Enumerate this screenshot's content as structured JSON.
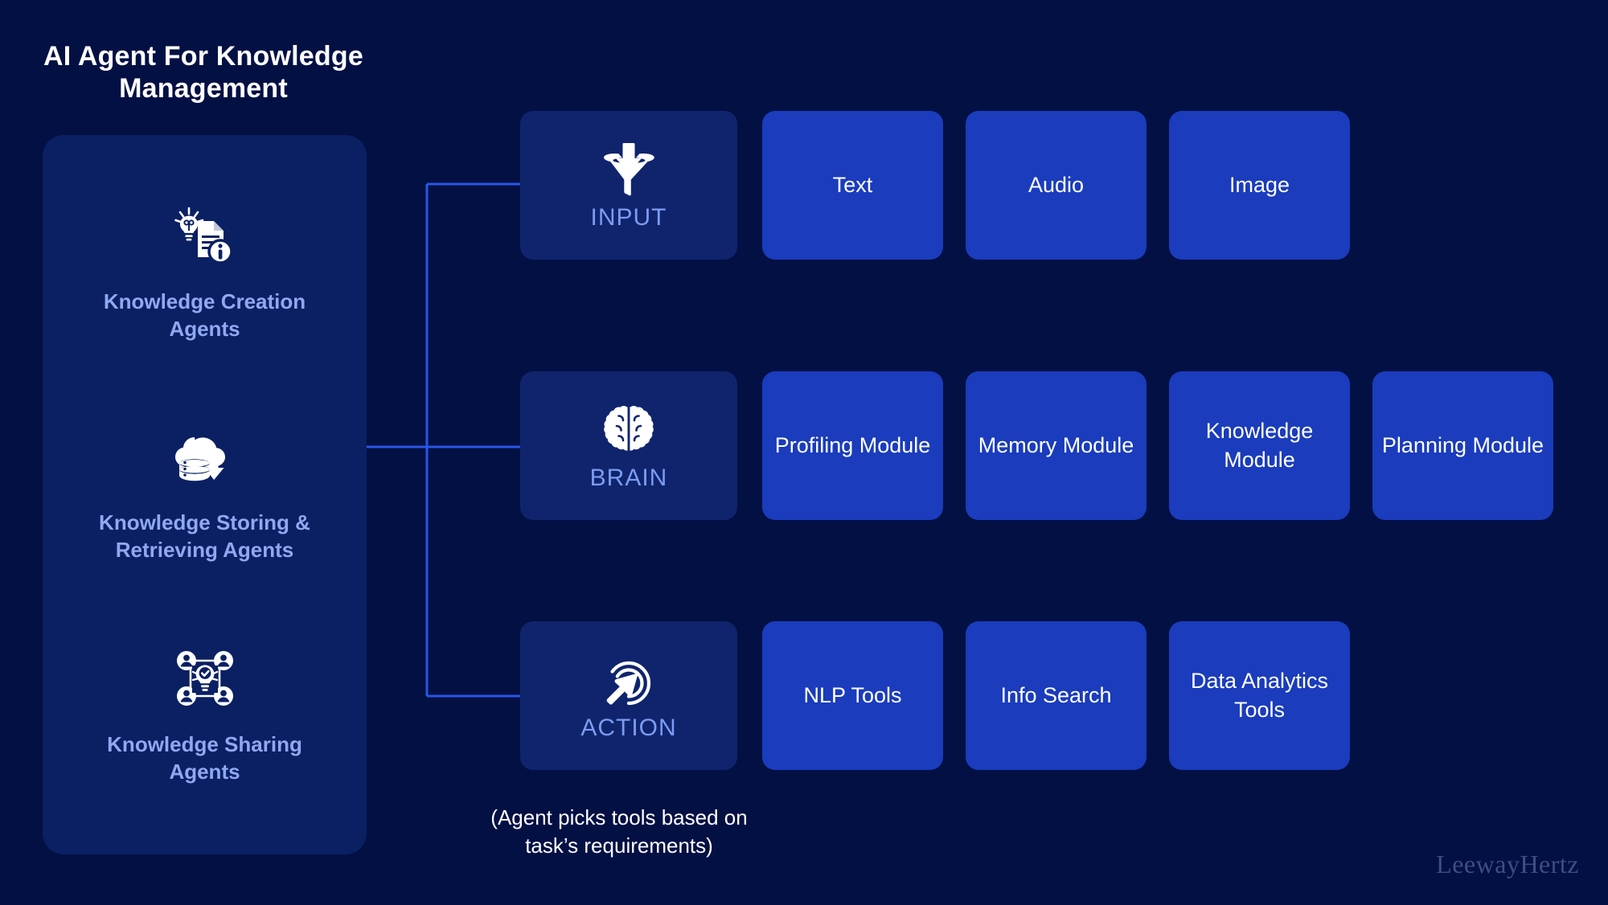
{
  "title": "AI Agent For Knowledge Management",
  "colors": {
    "background": "#021044",
    "panel": "#0a2063",
    "stage_card": "#10246e",
    "item_card": "#1a3cbd",
    "connector": "#2a56e8",
    "agent_label": "#8fa8ef",
    "stage_label": "#7c9cf0",
    "item_label": "#ffffff",
    "watermark": "#3c4f82"
  },
  "agents": {
    "items": [
      {
        "label": "Knowledge Creation Agents",
        "icon": "lightbulb-document-info-icon"
      },
      {
        "label": "Knowledge Storing & Retrieving Agents",
        "icon": "cloud-database-download-icon"
      },
      {
        "label": "Knowledge Sharing Agents",
        "icon": "people-network-idea-icon"
      }
    ]
  },
  "rows": [
    {
      "stage": "INPUT",
      "stage_icon": "funnel-input-icon",
      "items": [
        "Text",
        "Audio",
        "Image"
      ]
    },
    {
      "stage": "BRAIN",
      "stage_icon": "brain-icon",
      "items": [
        "Profiling Module",
        "Memory Module",
        "Knowledge Module",
        "Planning Module"
      ]
    },
    {
      "stage": "ACTION",
      "stage_icon": "cursor-click-action-icon",
      "items": [
        "NLP Tools",
        "Info Search",
        "Data Analytics Tools"
      ]
    }
  ],
  "footnote": "(Agent picks tools based on task’s requirements)",
  "watermark": "LeewayHertz"
}
